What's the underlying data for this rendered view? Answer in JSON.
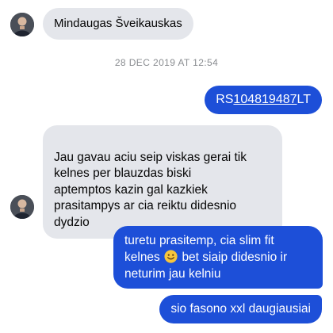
{
  "contact": {
    "name": "Mindaugas Šveikauskas",
    "avatar_icon": "contact-avatar-icon"
  },
  "timestamp": "28 DEC 2019 AT 12:54",
  "messages": [
    {
      "direction": "outgoing",
      "prefix": "RS",
      "link": "104819487",
      "suffix": "LT"
    },
    {
      "direction": "incoming",
      "text": "Jau gavau aciu seip viskas gerai tik\nkelnes per blauzdas biski\naptemptos kazin gal kazkiek\nprasitampys ar cia reiktu didesnio\ndydzio"
    },
    {
      "direction": "outgoing",
      "line1": "turetu prasitemp, cia slim fit",
      "line2_start": "kelnes",
      "emoji": "slightly-smiling-face-emoji",
      "line2_end": "bet siaip didesnio ir",
      "line3": "neturim jau kelniu"
    },
    {
      "direction": "outgoing",
      "text": "sio fasono xxl daugiausiai"
    }
  ],
  "colors": {
    "outgoing_bubble": "#1d4fd8",
    "incoming_bubble": "#e4e6eb",
    "timestamp_text": "#8a8d91"
  }
}
